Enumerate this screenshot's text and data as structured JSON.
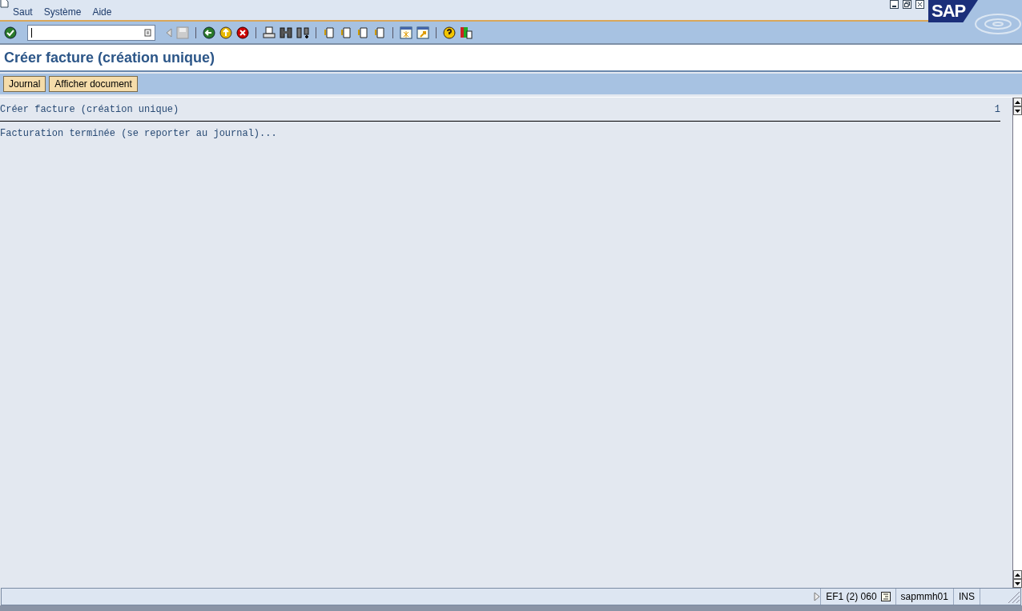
{
  "menu": [
    "Saut",
    "Système",
    "Aide"
  ],
  "logo": "SAP",
  "title": "Créer facture (création unique)",
  "app_toolbar": [
    "Journal",
    "Afficher document"
  ],
  "list": {
    "header": "Créer facture (création unique)",
    "page": "1",
    "lines": [
      "Facturation terminée (se reporter au journal)..."
    ]
  },
  "status_bar": {
    "system": "EF1 (2) 060",
    "server": "sapmmh01",
    "mode": "INS"
  }
}
